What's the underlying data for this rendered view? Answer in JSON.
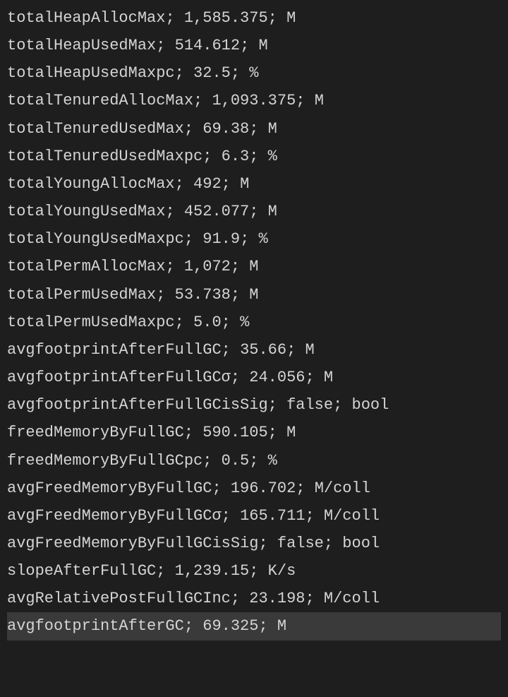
{
  "metrics": [
    {
      "name": "totalHeapAllocMax",
      "value": "1,585.375",
      "unit": "M",
      "highlight": false
    },
    {
      "name": "totalHeapUsedMax",
      "value": "514.612",
      "unit": "M",
      "highlight": false
    },
    {
      "name": "totalHeapUsedMaxpc",
      "value": "32.5",
      "unit": "%",
      "highlight": false
    },
    {
      "name": "totalTenuredAllocMax",
      "value": "1,093.375",
      "unit": "M",
      "highlight": false
    },
    {
      "name": "totalTenuredUsedMax",
      "value": "69.38",
      "unit": "M",
      "highlight": false
    },
    {
      "name": "totalTenuredUsedMaxpc",
      "value": "6.3",
      "unit": "%",
      "highlight": false
    },
    {
      "name": "totalYoungAllocMax",
      "value": "492",
      "unit": "M",
      "highlight": false
    },
    {
      "name": "totalYoungUsedMax",
      "value": "452.077",
      "unit": "M",
      "highlight": false
    },
    {
      "name": "totalYoungUsedMaxpc",
      "value": "91.9",
      "unit": "%",
      "highlight": false
    },
    {
      "name": "totalPermAllocMax",
      "value": "1,072",
      "unit": "M",
      "highlight": false
    },
    {
      "name": "totalPermUsedMax",
      "value": "53.738",
      "unit": "M",
      "highlight": false
    },
    {
      "name": "totalPermUsedMaxpc",
      "value": "5.0",
      "unit": "%",
      "highlight": false
    },
    {
      "name": "avgfootprintAfterFullGC",
      "value": "35.66",
      "unit": "M",
      "highlight": false
    },
    {
      "name": "avgfootprintAfterFullGCσ",
      "value": "24.056",
      "unit": "M",
      "highlight": false
    },
    {
      "name": "avgfootprintAfterFullGCisSig",
      "value": "false",
      "unit": "bool",
      "highlight": false
    },
    {
      "name": "freedMemoryByFullGC",
      "value": "590.105",
      "unit": "M",
      "highlight": false
    },
    {
      "name": "freedMemoryByFullGCpc",
      "value": "0.5",
      "unit": "%",
      "highlight": false
    },
    {
      "name": "avgFreedMemoryByFullGC",
      "value": "196.702",
      "unit": "M/coll",
      "highlight": false
    },
    {
      "name": "avgFreedMemoryByFullGCσ",
      "value": "165.711",
      "unit": "M/coll",
      "highlight": false
    },
    {
      "name": "avgFreedMemoryByFullGCisSig",
      "value": "false",
      "unit": "bool",
      "highlight": false
    },
    {
      "name": "slopeAfterFullGC",
      "value": "1,239.15",
      "unit": "K/s",
      "highlight": false
    },
    {
      "name": "avgRelativePostFullGCInc",
      "value": "23.198",
      "unit": "M/coll",
      "highlight": false
    },
    {
      "name": "avgfootprintAfterGC",
      "value": "69.325",
      "unit": "M",
      "highlight": true
    }
  ]
}
